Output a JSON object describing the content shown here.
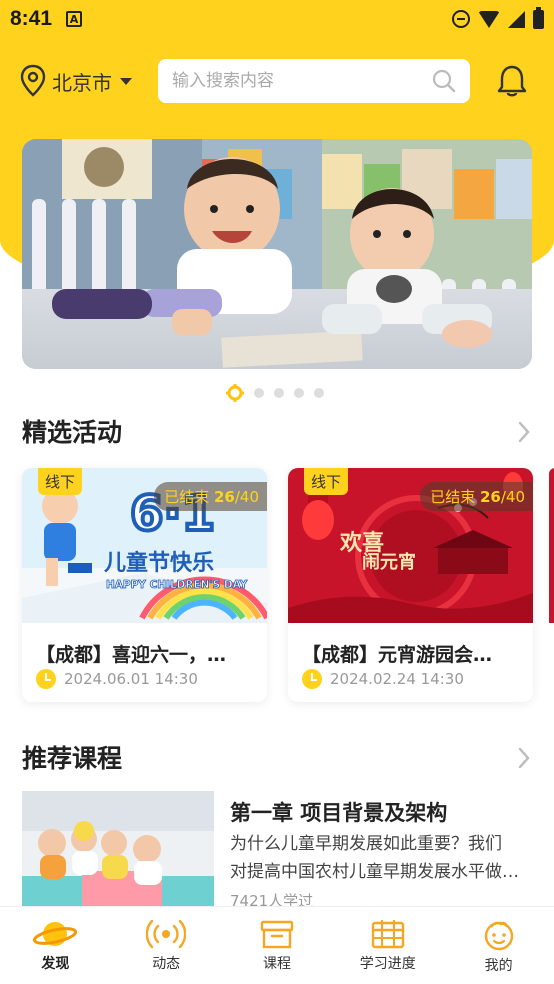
{
  "status_bar": {
    "time": "8:41",
    "notif_icon": "A"
  },
  "header": {
    "city": "北京市",
    "search_placeholder": "输入搜索内容"
  },
  "banner": {
    "dots": 5,
    "active_dot": 0
  },
  "featured": {
    "title": "精选活动",
    "cards": [
      {
        "tag": "线下",
        "status": "已结束",
        "count": "26",
        "total": "/40",
        "title": "【成都】喜迎六一，…",
        "time": "2024.06.01 14:30",
        "image_text": "儿童节快乐",
        "image_sub": "HAPPY CHILDREN'S DAY",
        "image_num": "6·1"
      },
      {
        "tag": "线下",
        "status": "已结束",
        "count": "26",
        "total": "/40",
        "title": "【成都】元宵游园会…",
        "time": "2024.02.24 14:30",
        "image_text_1": "欢喜",
        "image_text_2": "闹元宵"
      }
    ]
  },
  "courses": {
    "title": "推荐课程",
    "items": [
      {
        "title": "第一章 项目背景及架构",
        "desc_line1": "为什么儿童早期发展如此重要？我们",
        "desc_line2": "对提高中国农村儿童早期发展水平做…",
        "learners": "7421人学过"
      }
    ]
  },
  "nav": {
    "items": [
      {
        "label": "发现",
        "icon": "planet-icon",
        "active": true
      },
      {
        "label": "动态",
        "icon": "broadcast-icon",
        "active": false
      },
      {
        "label": "课程",
        "icon": "archive-box-icon",
        "active": false
      },
      {
        "label": "学习进度",
        "icon": "calendar-grid-icon",
        "active": false
      },
      {
        "label": "我的",
        "icon": "smiley-face-icon",
        "active": false
      }
    ]
  },
  "colors": {
    "accent": "#FFD21E",
    "text": "#222222",
    "muted": "#999999"
  }
}
